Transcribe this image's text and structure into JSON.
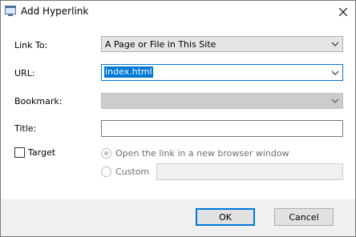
{
  "window": {
    "title": "Add Hyperlink"
  },
  "form": {
    "link_to": {
      "label": "Link To:",
      "value": "A Page or File in This Site"
    },
    "url": {
      "label": "URL:",
      "value": "index.html"
    },
    "bookmark": {
      "label": "Bookmark:",
      "value": ""
    },
    "title": {
      "label": "Title:",
      "value": ""
    },
    "target": {
      "label": "Target",
      "checked": false
    },
    "target_options": {
      "new_window_label": "Open the link in a new browser window",
      "custom_label": "Custom",
      "custom_value": ""
    }
  },
  "buttons": {
    "ok": "OK",
    "cancel": "Cancel"
  }
}
